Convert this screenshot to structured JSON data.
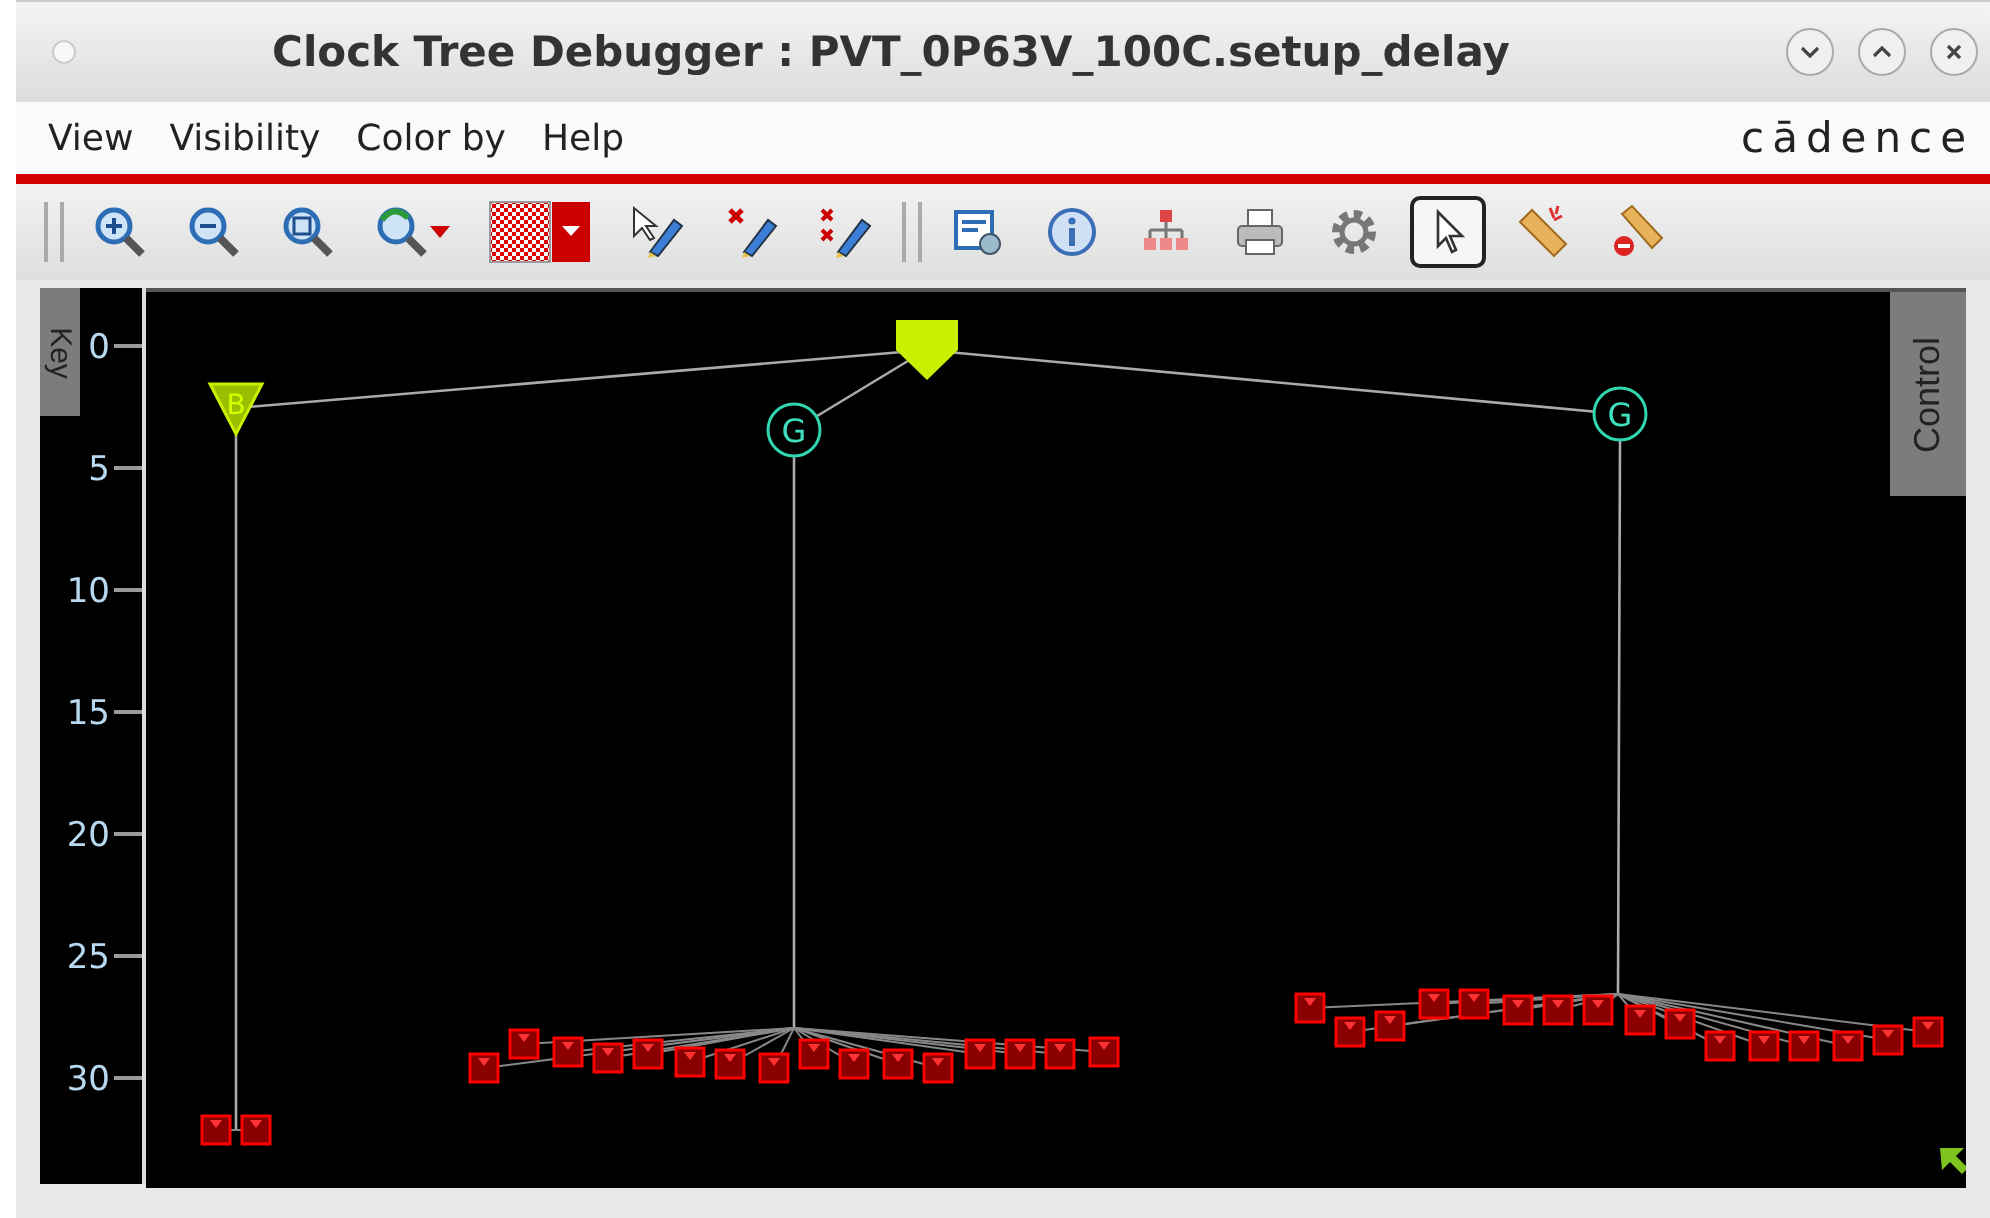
{
  "window": {
    "title": "Clock Tree Debugger : PVT_0P63V_100C.setup_delay"
  },
  "menu": [
    "View",
    "Visibility",
    "Color by",
    "Help"
  ],
  "logo": "cādence",
  "toolbar": [
    {
      "kind": "zoom-in",
      "selected": false
    },
    {
      "kind": "zoom-out",
      "selected": false
    },
    {
      "kind": "zoom-fit",
      "selected": false
    },
    {
      "kind": "zoom-back",
      "selected": false
    },
    {
      "kind": "pattern",
      "selected": false
    },
    {
      "kind": "pen-select",
      "selected": false
    },
    {
      "kind": "pen-mark",
      "selected": false
    },
    {
      "kind": "pen-clear",
      "selected": false
    },
    {
      "kind": "separator"
    },
    {
      "kind": "report",
      "selected": false
    },
    {
      "kind": "info",
      "selected": false
    },
    {
      "kind": "hierarchy",
      "selected": false
    },
    {
      "kind": "print",
      "selected": false
    },
    {
      "kind": "settings",
      "selected": false
    },
    {
      "kind": "pointer",
      "selected": true
    },
    {
      "kind": "ruler",
      "selected": false
    },
    {
      "kind": "ruler-clear",
      "selected": false
    }
  ],
  "axis": {
    "ticks": [
      "0",
      "5",
      "10",
      "15",
      "20",
      "25",
      "30"
    ]
  },
  "tabs": {
    "left": "Key",
    "right": "Control"
  },
  "tree": {
    "kind": "source",
    "children": [
      {
        "kind": "buffer",
        "label": "B"
      },
      {
        "kind": "gate",
        "label": "G"
      },
      {
        "kind": "gate",
        "label": "G"
      }
    ]
  }
}
